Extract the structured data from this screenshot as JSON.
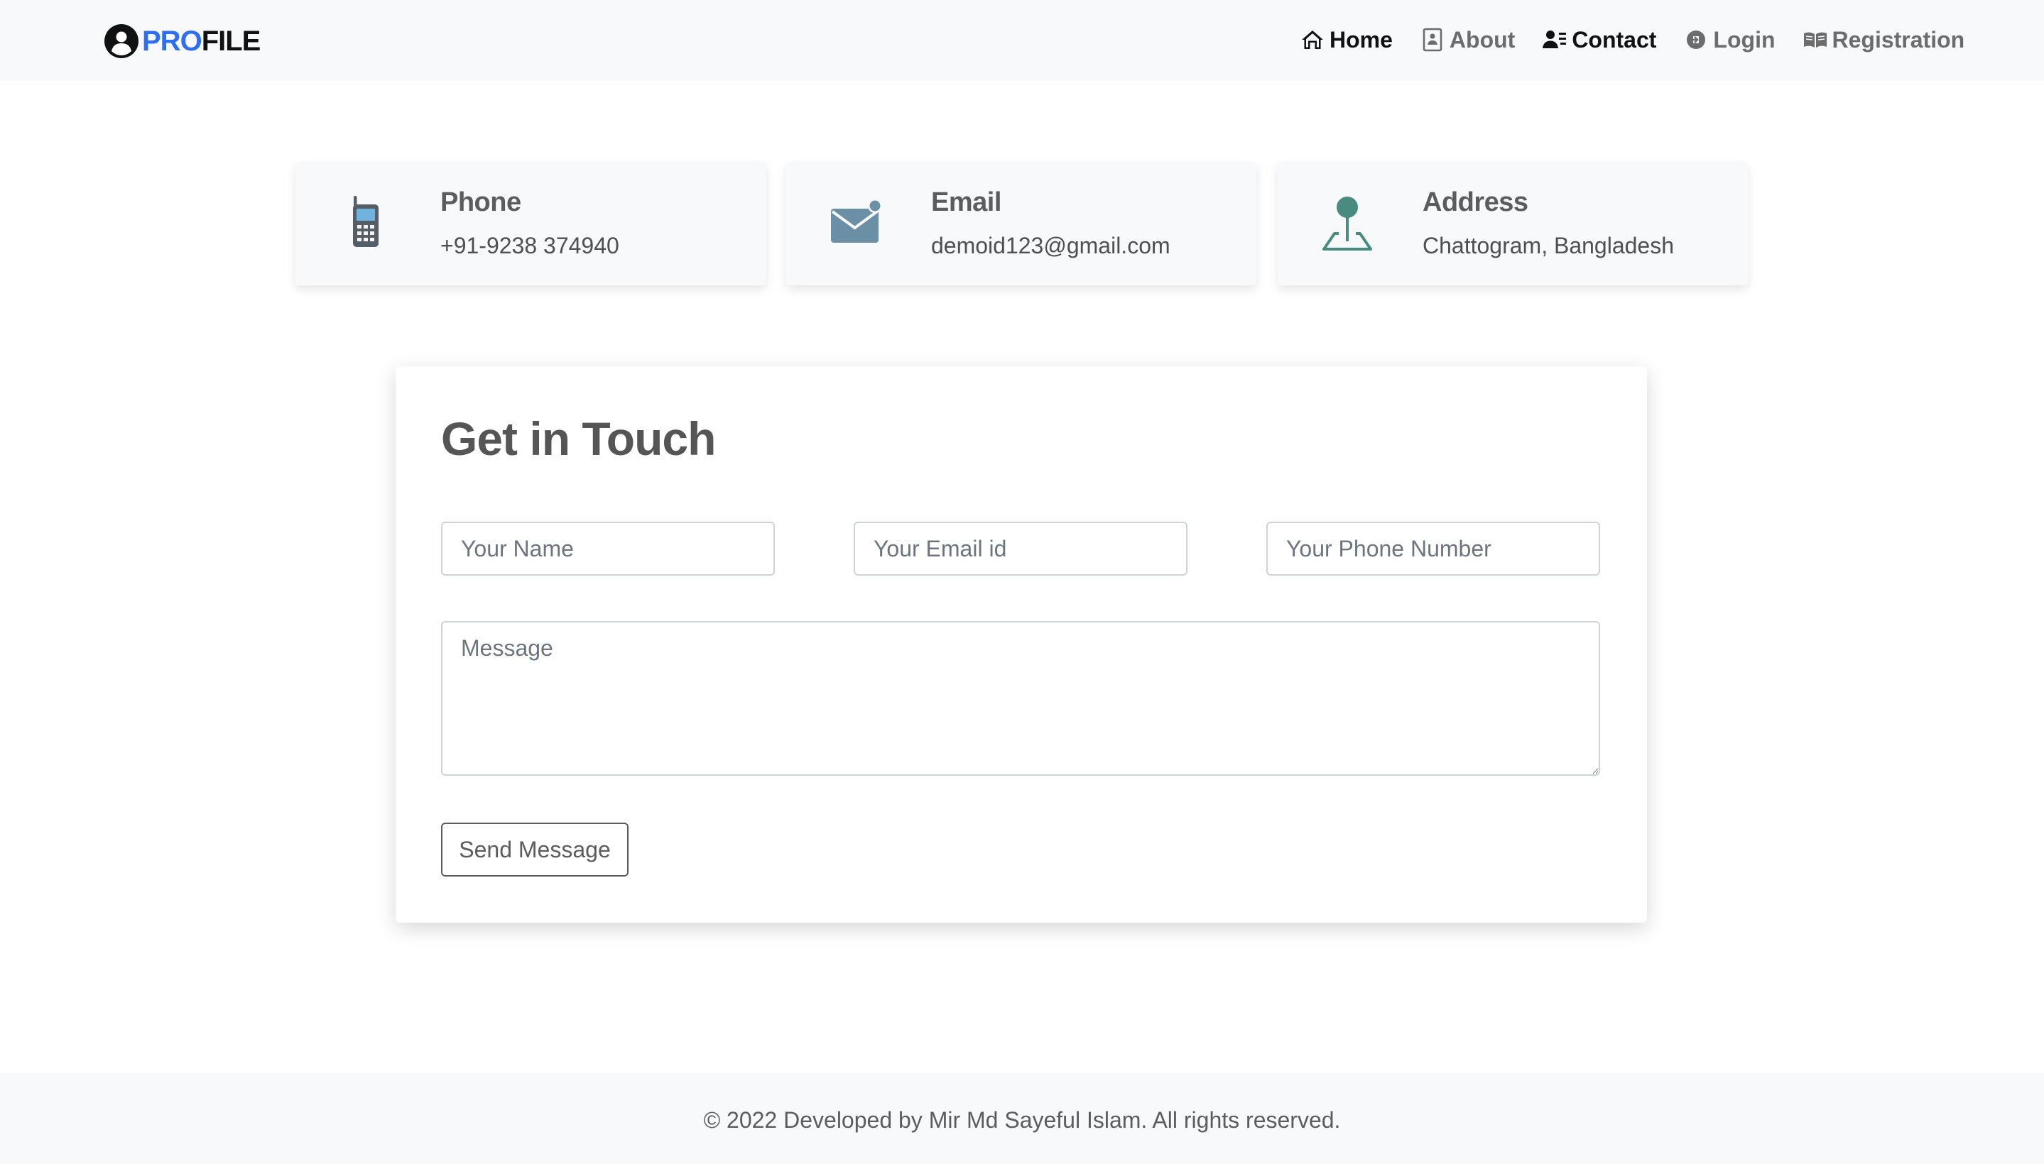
{
  "brand": {
    "pro": "PRO",
    "file": "FILE",
    "icon": "user-circle-icon",
    "accent_color": "#2d6ef3"
  },
  "nav": {
    "items": [
      {
        "label": "Home",
        "icon": "home-icon",
        "active": true
      },
      {
        "label": "About",
        "icon": "document-icon",
        "active": false
      },
      {
        "label": "Contact",
        "icon": "contact-card-icon",
        "active": true
      },
      {
        "label": "Login",
        "icon": "login-icon",
        "active": false
      },
      {
        "label": "Registration",
        "icon": "book-icon",
        "active": false
      }
    ]
  },
  "contact_cards": [
    {
      "title": "Phone",
      "value": "+91-9238 374940",
      "icon": "mobile-phone-icon"
    },
    {
      "title": "Email",
      "value": "demoid123@gmail.com",
      "icon": "envelope-icon"
    },
    {
      "title": "Address",
      "value": "Chattogram, Bangladesh",
      "icon": "map-pin-icon"
    }
  ],
  "form": {
    "title": "Get in Touch",
    "name_placeholder": "Your Name",
    "email_placeholder": "Your Email id",
    "phone_placeholder": "Your Phone Number",
    "message_placeholder": "Message",
    "submit_label": "Send Message"
  },
  "footer": {
    "text": "© 2022 Developed by Mir Md Sayeful Islam. All rights reserved."
  }
}
